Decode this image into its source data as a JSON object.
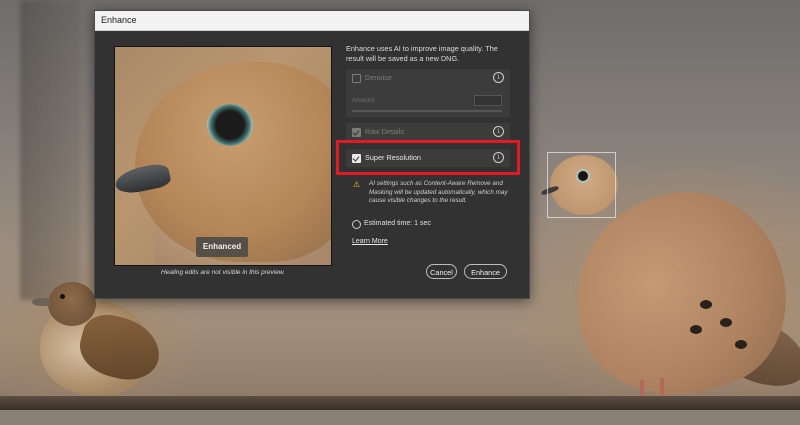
{
  "dialog": {
    "title": "Enhance",
    "description": "Enhance uses AI to improve image quality. The result will be saved as a new DNG.",
    "preview_label": "Enhanced",
    "preview_note": "Healing edits are not visible in this preview.",
    "options": [
      {
        "label": "Denoise",
        "checked": false,
        "enabled": false
      },
      {
        "label": "Raw Details",
        "checked": true,
        "enabled": false
      },
      {
        "label": "Super Resolution",
        "checked": true,
        "enabled": true
      }
    ],
    "amount_label": "Amount",
    "warning_text": "AI settings such as Content-Aware Remove and Masking will be updated automatically, which may cause visible changes to the result.",
    "estimated_time": "Estimated time: 1 sec",
    "learn_more": "Learn More",
    "cancel_label": "Cancel",
    "enhance_label": "Enhance"
  },
  "icons": {
    "info": "info-icon",
    "warning": "warning-icon",
    "timer": "stopwatch-icon"
  },
  "colors": {
    "highlight": "#e01b24",
    "warning": "#f2c316",
    "dialog_bg": "#323232"
  }
}
